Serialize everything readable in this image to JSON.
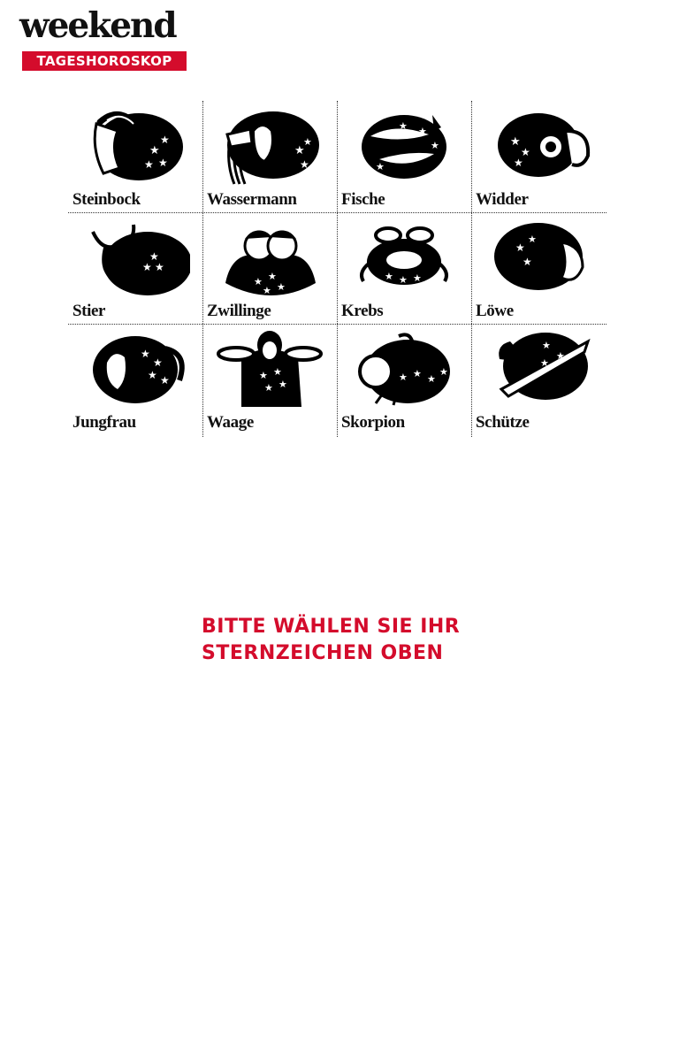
{
  "brand": {
    "logo": "weekend",
    "badge": "TAGESHOROSKOP",
    "accent_color": "#d40c2c"
  },
  "signs": [
    {
      "label": "Steinbock",
      "icon": "capricorn-icon"
    },
    {
      "label": "Wassermann",
      "icon": "aquarius-icon"
    },
    {
      "label": "Fische",
      "icon": "pisces-icon"
    },
    {
      "label": "Widder",
      "icon": "aries-icon"
    },
    {
      "label": "Stier",
      "icon": "taurus-icon"
    },
    {
      "label": "Zwillinge",
      "icon": "gemini-icon"
    },
    {
      "label": "Krebs",
      "icon": "cancer-icon"
    },
    {
      "label": "Löwe",
      "icon": "leo-icon"
    },
    {
      "label": "Jungfrau",
      "icon": "virgo-icon"
    },
    {
      "label": "Waage",
      "icon": "libra-icon"
    },
    {
      "label": "Skorpion",
      "icon": "scorpio-icon"
    },
    {
      "label": "Schütze",
      "icon": "sagittarius-icon"
    }
  ],
  "prompt": {
    "line1": "BITTE WÄHLEN SIE IHR",
    "line2": "STERNZEICHEN OBEN"
  }
}
